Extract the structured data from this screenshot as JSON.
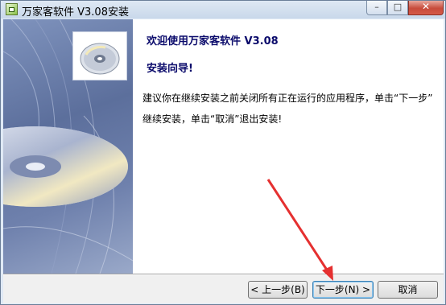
{
  "window": {
    "title": "万家客软件 V3.08安装",
    "controls": {
      "minimize": "–",
      "maximize": "□",
      "close": "✕"
    }
  },
  "content": {
    "welcome_title": "欢迎使用万家客软件 V3.08",
    "welcome_subtitle": "安装向导!",
    "body_lines": [
      "建议你在继续安装之前关闭所有正在运行的应用程序，单击“下一步”",
      "继续安装，单击“取消”退出安装!"
    ]
  },
  "buttons": {
    "back": "< 上一步(B)",
    "next": "下一步(N) >",
    "cancel": "取消"
  },
  "colors": {
    "title_text": "#0a0a6b",
    "annotation_arrow": "#e53030"
  },
  "icons": [
    "app-icon",
    "cd-icon",
    "minimize-icon",
    "maximize-icon",
    "close-icon"
  ]
}
